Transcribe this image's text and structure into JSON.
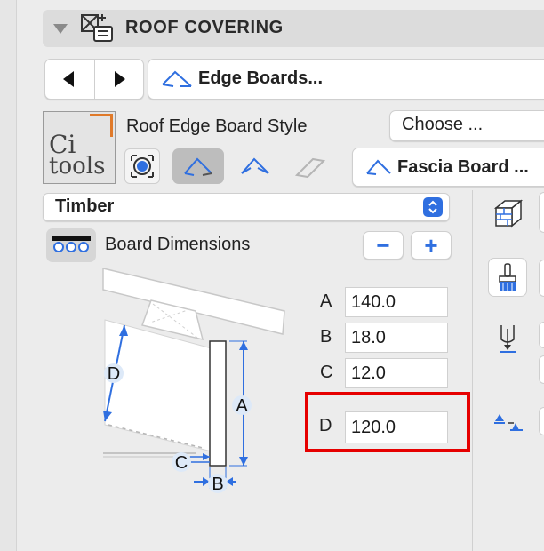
{
  "section": {
    "title": "ROOF COVERING"
  },
  "nav": {
    "preset_label": "Edge Boards..."
  },
  "logo": {
    "line1": "Ci",
    "line2": "tools"
  },
  "style_row": {
    "label": "Roof Edge Board Style",
    "choose_label": "Choose ...",
    "board_label": "Fascia Board ..."
  },
  "material": {
    "selected": "Timber"
  },
  "dimensions": {
    "title": "Board Dimensions",
    "rows": [
      {
        "letter": "A",
        "value": "140.0"
      },
      {
        "letter": "B",
        "value": "18.0"
      },
      {
        "letter": "C",
        "value": "12.0"
      },
      {
        "letter": "D",
        "value": "120.0"
      }
    ],
    "minus_label": "−",
    "plus_label": "+"
  },
  "diagram": {
    "labels": {
      "A": "A",
      "B": "B",
      "C": "C",
      "D": "D"
    }
  },
  "colors": {
    "accent": "#2f6fe0",
    "highlight": "#e60000",
    "logo_orange": "#e07a2a"
  }
}
